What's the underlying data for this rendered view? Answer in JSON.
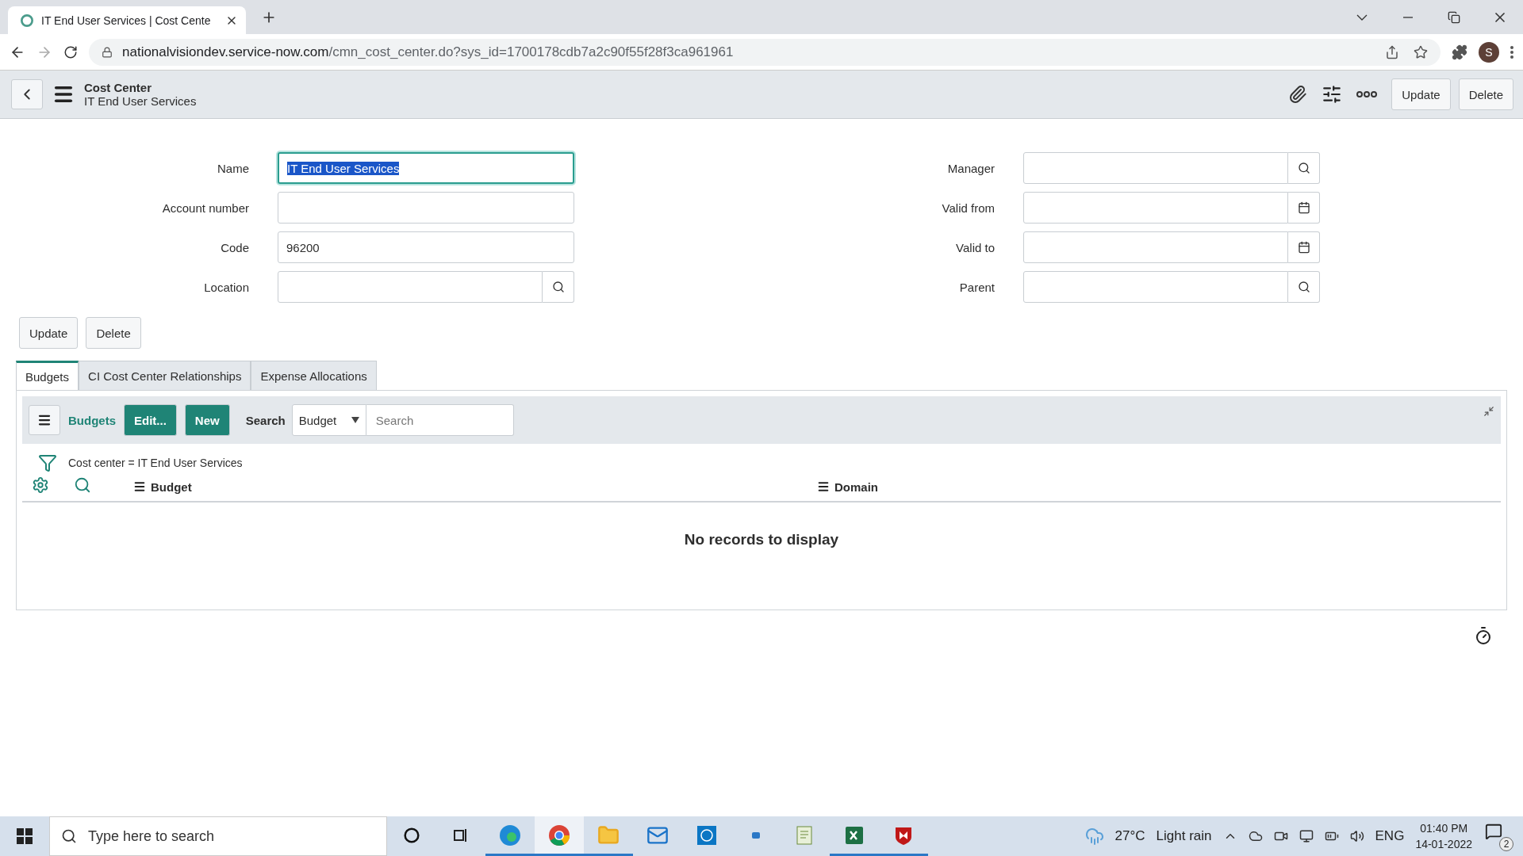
{
  "browser": {
    "tab_title": "IT End User Services | Cost Cente",
    "url_host": "nationalvisiondev.service-now.com",
    "url_path": "/cmn_cost_center.do?sys_id=1700178cdb7a2c90f55f28f3ca961961",
    "profile_initial": "S"
  },
  "header": {
    "table": "Cost Center",
    "record": "IT End User Services",
    "buttons": [
      "Update",
      "Delete"
    ]
  },
  "form": {
    "left": [
      {
        "label": "Name",
        "kind": "text",
        "value": "IT End User Services",
        "focused": true
      },
      {
        "label": "Account number",
        "kind": "text",
        "focused": false
      },
      {
        "label": "Code",
        "kind": "text",
        "value": "96200",
        "focused": false
      },
      {
        "label": "Location",
        "kind": "lookup",
        "focused": false
      }
    ],
    "right": [
      {
        "label": "Manager",
        "kind": "lookup",
        "focused": false
      },
      {
        "label": "Valid from",
        "kind": "date",
        "focused": false
      },
      {
        "label": "Valid to",
        "kind": "date",
        "focused": false
      },
      {
        "label": "Parent",
        "kind": "lookup",
        "focused": false
      }
    ]
  },
  "form_buttons": [
    "Update",
    "Delete"
  ],
  "related_tabs": [
    {
      "label": "Budgets",
      "selected": true
    },
    {
      "label": "CI Cost Center Relationships",
      "selected": false
    },
    {
      "label": "Expense Allocations",
      "selected": false
    }
  ],
  "related_list": {
    "title": "Budgets",
    "buttons": [
      "Edit...",
      "New"
    ],
    "search_label": "Search",
    "search_field": "Budget",
    "search_placeholder": "Search",
    "filter": "Cost center = IT End User Services",
    "columns": [
      "Budget",
      "Domain"
    ],
    "empty_message": "No records to display"
  },
  "taskbar": {
    "search_placeholder": "Type here to search",
    "apps": [
      {
        "kind": "edge",
        "running": true,
        "selected": false
      },
      {
        "kind": "chrome",
        "running": true,
        "selected": true
      },
      {
        "kind": "explorer",
        "running": true,
        "selected": false
      },
      {
        "kind": "mail",
        "running": false,
        "selected": false
      },
      {
        "kind": "dell",
        "running": false,
        "selected": false
      },
      {
        "kind": "small",
        "running": false,
        "selected": false
      },
      {
        "kind": "notepad",
        "running": false,
        "selected": false
      },
      {
        "kind": "excel",
        "running": true,
        "selected": false
      },
      {
        "kind": "shield",
        "running": true,
        "selected": false
      }
    ],
    "temperature": "27°C",
    "weather": "Light rain",
    "language": "ENG",
    "time": "01:40 PM",
    "date": "14-01-2022",
    "notifications": "2"
  }
}
